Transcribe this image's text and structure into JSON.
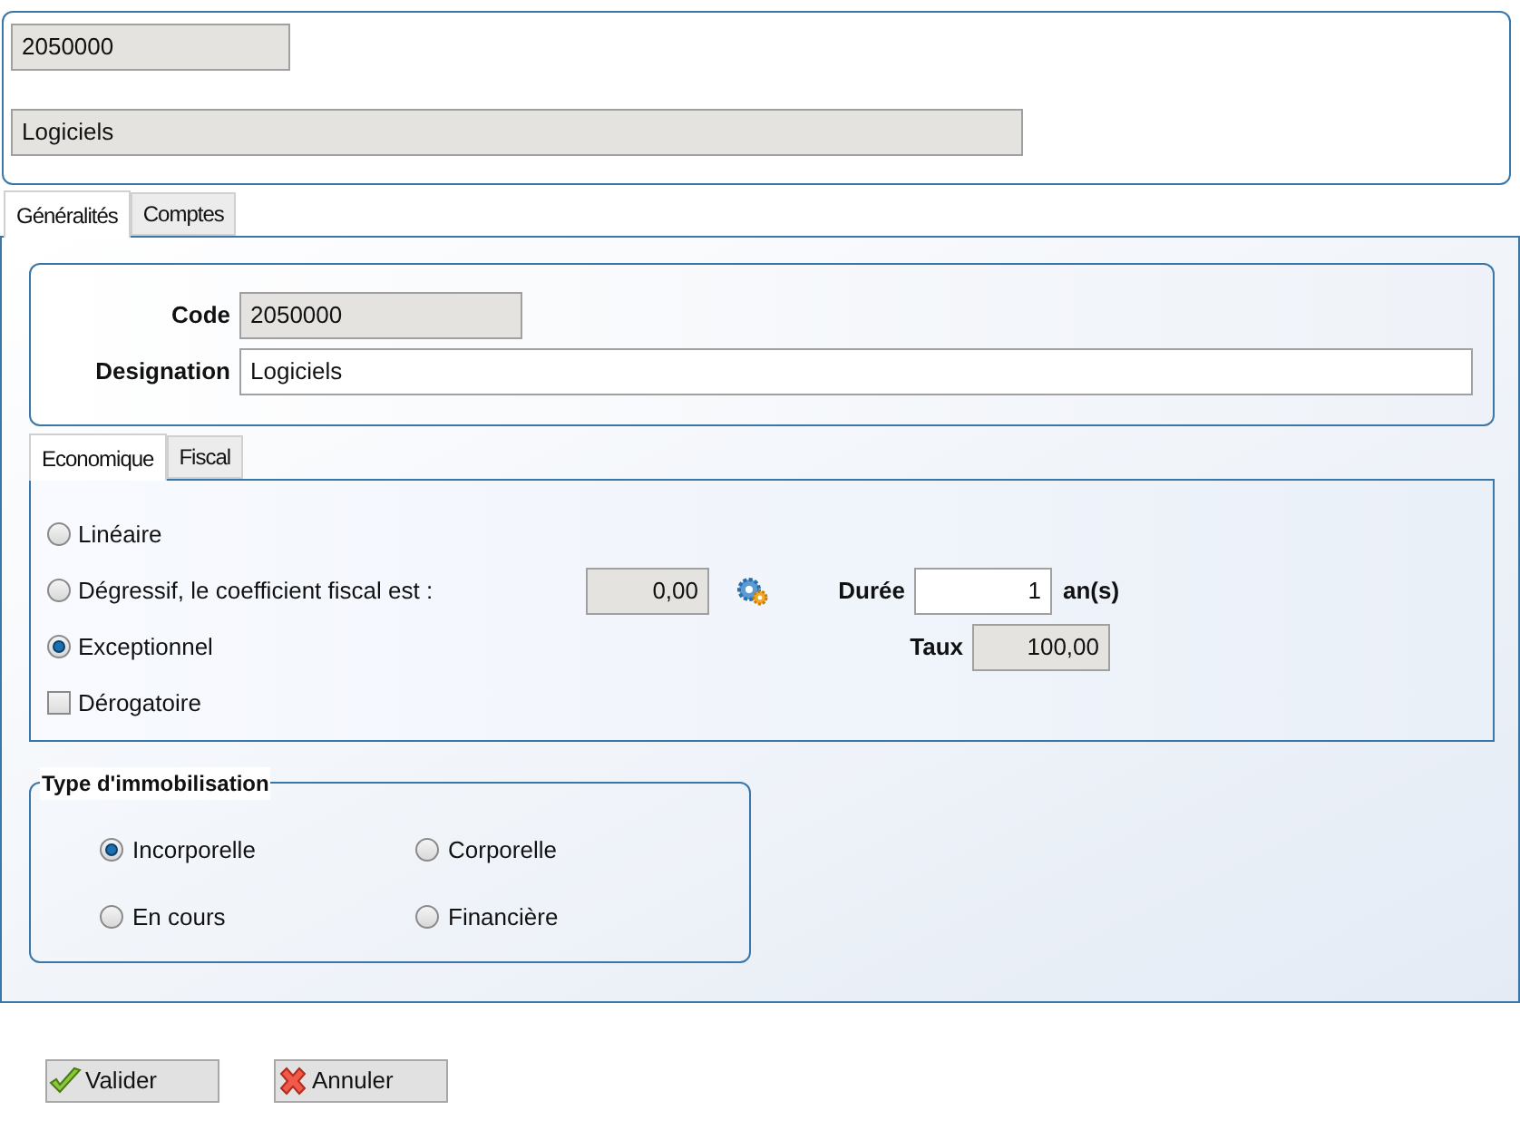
{
  "header": {
    "code": "2050000",
    "designation": "Logiciels"
  },
  "tabs": [
    {
      "label": "Généralités",
      "selected": true
    },
    {
      "label": "Comptes",
      "selected": false
    }
  ],
  "identity": {
    "code_label": "Code",
    "code": "2050000",
    "designation_label": "Designation",
    "designation": "Logiciels"
  },
  "sub_tabs": [
    {
      "label": "Economique",
      "selected": true
    },
    {
      "label": "Fiscal",
      "selected": false
    }
  ],
  "methods": [
    {
      "kind": "radio",
      "label": "Linéaire",
      "selected": false
    },
    {
      "kind": "radio",
      "label": "Dégressif, le coefficient fiscal est :",
      "selected": false
    },
    {
      "kind": "radio",
      "label": "Exceptionnel",
      "selected": true
    },
    {
      "kind": "checkbox",
      "label": "Dérogatoire",
      "checked": false
    }
  ],
  "coefficient": "0,00",
  "duree": {
    "label": "Durée",
    "value": "1",
    "unit": "an(s)"
  },
  "taux": {
    "label": "Taux",
    "value": "100,00"
  },
  "type_group": {
    "title": "Type d'immobilisation",
    "options": [
      {
        "label": "Incorporelle",
        "selected": true
      },
      {
        "label": "Corporelle",
        "selected": false
      },
      {
        "label": "En cours",
        "selected": false
      },
      {
        "label": "Financière",
        "selected": false
      }
    ]
  },
  "buttons": [
    {
      "kind": "ok",
      "label": "Valider"
    },
    {
      "kind": "cancel",
      "label": "Annuler"
    }
  ]
}
